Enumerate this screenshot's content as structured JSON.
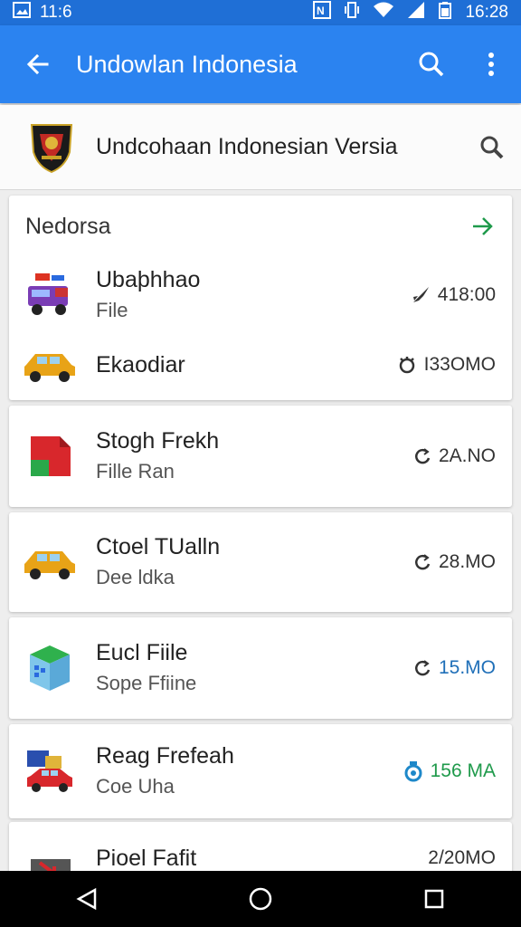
{
  "status_bar": {
    "left_time": "11:6",
    "right_time": "16:28"
  },
  "app_bar": {
    "title": "Undowlan Indonesia"
  },
  "search_row": {
    "title": "Undcohaan Indonesian Versia"
  },
  "section": {
    "title": "Nedorsa",
    "items": [
      {
        "name": "Ubaþhhao",
        "sub": "File",
        "meta": "418:00"
      },
      {
        "name": "Ekaodiar",
        "sub": "",
        "meta": "I33OMO"
      }
    ]
  },
  "cards": [
    {
      "name": "Stogh Frekh",
      "sub": "Fille Ran",
      "meta": "2A.NO"
    },
    {
      "name": "Ctoel TUalln",
      "sub": "Dee ldka",
      "meta": "28.MO"
    },
    {
      "name": "Eucl Fiile",
      "sub": "Sope Ffiine",
      "meta": "15.MO"
    },
    {
      "name": "Reag Frefeah",
      "sub": "Coe Uha",
      "meta": "156 MA"
    },
    {
      "name": "Pioel Fafit",
      "sub": "",
      "meta": "2/20MO"
    }
  ],
  "colors": {
    "status_bar": "#1f6fd6",
    "app_bar": "#2b83f0",
    "accent_green": "#1f9a4b",
    "meta_blue": "#1f6fb8"
  },
  "icons": {
    "back": "arrow-left-icon",
    "search": "search-icon",
    "more": "more-vert-icon"
  }
}
